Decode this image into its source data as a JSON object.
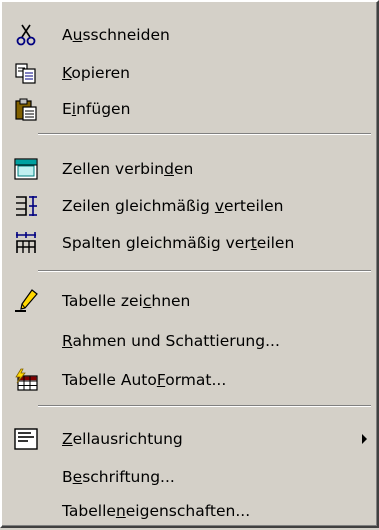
{
  "menu": {
    "items": [
      {
        "id": "cut",
        "pre": "A",
        "ul": "u",
        "post": "sschneiden",
        "icon": "scissors-icon"
      },
      {
        "id": "copy",
        "pre": "",
        "ul": "K",
        "post": "opieren",
        "icon": "copy-icon"
      },
      {
        "id": "paste",
        "pre": "E",
        "ul": "i",
        "post": "nfügen",
        "icon": "paste-icon"
      },
      {
        "id": "merge-cells",
        "pre": "Zellen verbin",
        "ul": "d",
        "post": "en",
        "icon": "merge-cells-icon"
      },
      {
        "id": "distribute-rows",
        "pre": "Zeilen gleichmäßig ",
        "ul": "v",
        "post": "erteilen",
        "icon": "distribute-rows-icon"
      },
      {
        "id": "distribute-columns",
        "pre": "Spalten gleichmäßig ver",
        "ul": "t",
        "post": "eilen",
        "icon": "distribute-columns-icon"
      },
      {
        "id": "draw-table",
        "pre": "Tabelle zei",
        "ul": "c",
        "post": "hnen",
        "icon": "pencil-icon"
      },
      {
        "id": "borders-shading",
        "pre": "",
        "ul": "R",
        "post": "ahmen und Schattierung...",
        "icon": ""
      },
      {
        "id": "table-autoformat",
        "pre": "Tabelle Auto",
        "ul": "F",
        "post": "ormat...",
        "icon": "table-autoformat-icon"
      },
      {
        "id": "cell-alignment",
        "pre": "",
        "ul": "Z",
        "post": "ellausrichtung",
        "icon": "cell-alignment-icon",
        "submenu": true
      },
      {
        "id": "caption",
        "pre": "B",
        "ul": "e",
        "post": "schriftung...",
        "icon": ""
      },
      {
        "id": "table-properties",
        "pre": "Tabelle",
        "ul": "n",
        "post": "eigenschaften...",
        "icon": ""
      }
    ]
  }
}
